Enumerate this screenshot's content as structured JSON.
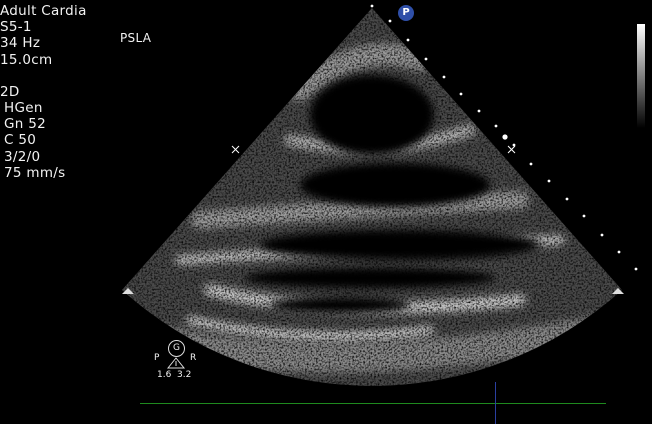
{
  "settings": {
    "preset": "Adult Cardia",
    "probe": "S5-1",
    "frame_rate": "34 Hz",
    "depth": "15.0cm",
    "mode": "2D",
    "harmonic": "HGen",
    "gain": "Gn 52",
    "compression": "C 50",
    "processing": "3/2/0",
    "sweep_speed": "75 mm/s"
  },
  "view_label": "PSLA",
  "orientation_marker": "P",
  "gain_indicator": "G",
  "orientation": {
    "left": "P",
    "right": "R"
  },
  "focus_values": "1.6  3.2",
  "colors": {
    "background": "#000000",
    "timeline": "#1e8a1e",
    "cursor": "#2a3fa0",
    "marker": "#2f4fa8"
  },
  "icons": [
    "triangle-marker-icon",
    "focus-x-icon",
    "gain-g-icon",
    "grayscale-bar"
  ]
}
